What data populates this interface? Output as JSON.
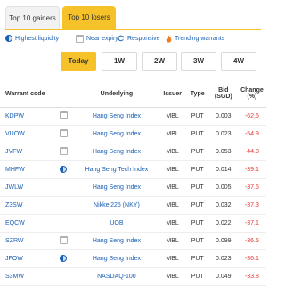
{
  "tabs": [
    {
      "label": "Top 10 gainers",
      "active": false
    },
    {
      "label": "Top 10 losers",
      "active": true
    }
  ],
  "filters": {
    "highest_liquidity": "Highest liquidity",
    "near_expiry": "Near expiry",
    "responsive": "Responsive",
    "trending_warrants": "Trending warrants"
  },
  "periods": [
    {
      "label": "Today",
      "active": true
    },
    {
      "label": "1W",
      "active": false
    },
    {
      "label": "2W",
      "active": false
    },
    {
      "label": "3W",
      "active": false
    },
    {
      "label": "4W",
      "active": false
    }
  ],
  "table": {
    "headers": {
      "code": "Warrant code",
      "underlying": "Underlying",
      "issuer": "Issuer",
      "type": "Type",
      "bid_line1": "Bid",
      "bid_line2": "(SGD)",
      "change_line1": "Change",
      "change_line2": "(%)"
    },
    "rows": [
      {
        "code": "KDPW",
        "icon": "calendar-icon",
        "underlying": "Hang Seng Index",
        "issuer": "MBL",
        "type": "PUT",
        "bid": "0.003",
        "change": "-62.5"
      },
      {
        "code": "VUOW",
        "icon": "calendar-icon",
        "underlying": "Hang Seng Index",
        "issuer": "MBL",
        "type": "PUT",
        "bid": "0.023",
        "change": "-54.9"
      },
      {
        "code": "JVFW",
        "icon": "calendar-icon",
        "underlying": "Hang Seng Index",
        "issuer": "MBL",
        "type": "PUT",
        "bid": "0.053",
        "change": "-44.8"
      },
      {
        "code": "MHFW",
        "icon": "liquidity-icon",
        "underlying": "Hang Seng Tech Index",
        "issuer": "MBL",
        "type": "PUT",
        "bid": "0.014",
        "change": "-39.1"
      },
      {
        "code": "JWLW",
        "icon": "",
        "underlying": "Hang Seng Index",
        "issuer": "MBL",
        "type": "PUT",
        "bid": "0.005",
        "change": "-37.5"
      },
      {
        "code": "Z3SW",
        "icon": "",
        "underlying": "Nikkei225 (NKY)",
        "issuer": "MBL",
        "type": "PUT",
        "bid": "0.032",
        "change": "-37.3"
      },
      {
        "code": "EQCW",
        "icon": "",
        "underlying": "UOB",
        "issuer": "MBL",
        "type": "PUT",
        "bid": "0.022",
        "change": "-37.1"
      },
      {
        "code": "SZRW",
        "icon": "calendar-icon",
        "underlying": "Hang Seng Index",
        "issuer": "MBL",
        "type": "PUT",
        "bid": "0.099",
        "change": "-36.5"
      },
      {
        "code": "JFOW",
        "icon": "liquidity-icon",
        "underlying": "Hang Seng Index",
        "issuer": "MBL",
        "type": "PUT",
        "bid": "0.023",
        "change": "-36.1"
      },
      {
        "code": "S3MW",
        "icon": "",
        "underlying": "NASDAQ-100",
        "issuer": "MBL",
        "type": "PUT",
        "bid": "0.049",
        "change": "-33.8"
      }
    ]
  },
  "colors": {
    "accent": "#f6c229",
    "link": "#1a5fb4",
    "negative": "#e53935",
    "trending": "#f07c1c"
  }
}
